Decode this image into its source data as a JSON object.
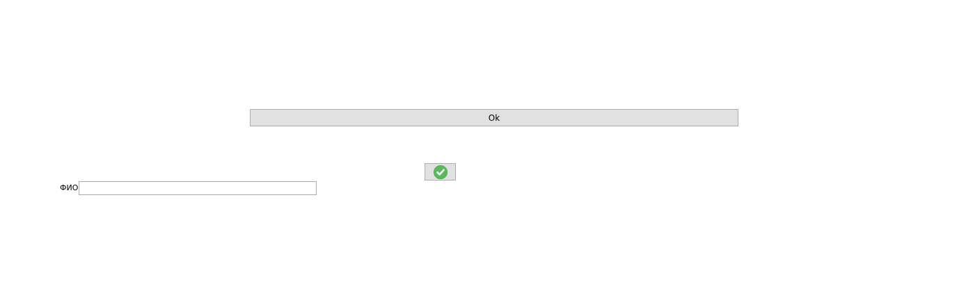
{
  "form": {
    "ok_button_label": "Ok",
    "confirm_button_icon": "checkmark-icon",
    "fio_label": "ФИО",
    "fio_value": "",
    "fio_placeholder": ""
  },
  "colors": {
    "page_background": "#ffffff",
    "button_background": "#e1e1e1",
    "button_border": "#adadad",
    "checkmark_circle": "#5cb85c",
    "checkmark_tick": "#ffffff"
  }
}
